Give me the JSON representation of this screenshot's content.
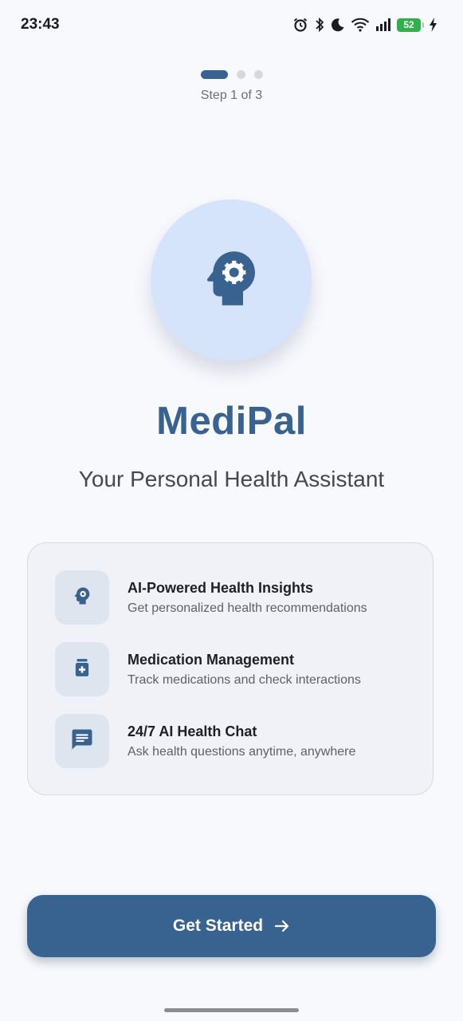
{
  "status_bar": {
    "time": "23:43",
    "icons": [
      "alarm-icon",
      "bluetooth-icon",
      "moon-icon",
      "wifi-icon",
      "signal-icon",
      "battery-icon",
      "charging-icon"
    ],
    "battery_level": "52"
  },
  "stepper": {
    "total_steps": 3,
    "current_step": 1,
    "label": "Step 1 of 3"
  },
  "hero": {
    "icon": "head-gear-icon",
    "title": "MediPal",
    "tagline": "Your Personal Health Assistant"
  },
  "features": [
    {
      "icon": "head-gear-icon",
      "title": "AI-Powered Health Insights",
      "description": "Get personalized health recommendations"
    },
    {
      "icon": "medication-icon",
      "title": "Medication Management",
      "description": "Track medications and check interactions"
    },
    {
      "icon": "chat-icon",
      "title": "24/7 AI Health Chat",
      "description": "Ask health questions anytime, anywhere"
    }
  ],
  "cta": {
    "label": "Get Started",
    "icon": "arrow-right-icon"
  },
  "colors": {
    "primary": "#386290",
    "background": "#f8f9fd",
    "hero_circle": "#d6e4fb",
    "card": "#f0f2f7",
    "battery": "#2fb14a"
  }
}
